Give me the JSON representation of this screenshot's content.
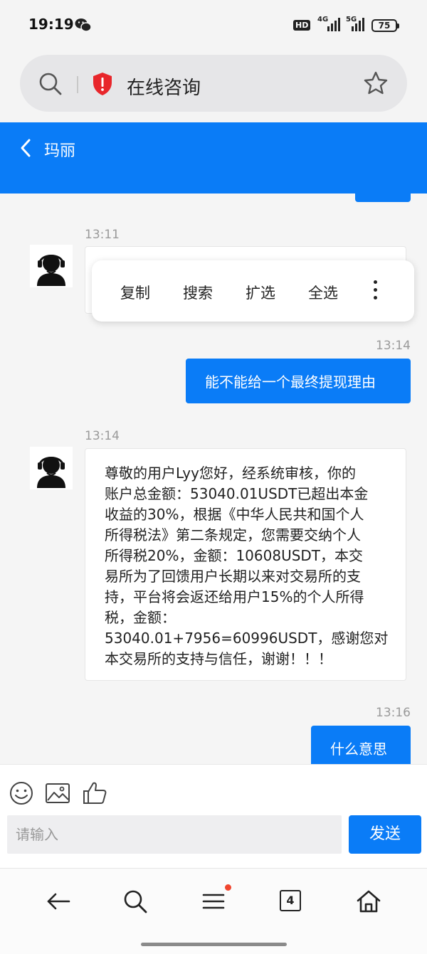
{
  "status_bar": {
    "time": "19:19",
    "hd_label": "HD",
    "network_1": "4G",
    "network_2": "5G",
    "battery": "75"
  },
  "browser": {
    "page_title": "在线咨询"
  },
  "chat": {
    "contact_name": "玛丽",
    "messages": [
      {
        "time": "13:11",
        "side": "left"
      },
      {
        "time": "13:14",
        "side": "right",
        "text": "能不能给一个最终提现理由"
      },
      {
        "time": "13:14",
        "side": "left",
        "text": "尊敬的用户Lyy您好，经系统审核，你的\n账户总金额：53040.01USDT已超出本金\n收益的30%，根据《中华人民共和国个人\n所得税法》第二条规定，您需要交纳个人\n所得税20%，金额：10608USDT，本交\n易所为了回馈用户长期以来对交易所的支\n持，平台将会返还给用户15%的个人所得\n税，金额：\n53040.01+7956=60996USDT，感谢您对\n本交易所的支持与信任，谢谢！！！"
      },
      {
        "time": "13:16",
        "side": "right",
        "text": "什么意思"
      }
    ]
  },
  "context_menu": {
    "items": [
      "复制",
      "搜索",
      "扩选",
      "全选"
    ]
  },
  "composer": {
    "placeholder": "请输入",
    "send_label": "发送"
  },
  "bottom_nav": {
    "tab_count": "4"
  },
  "colors": {
    "accent": "#0a7cf7",
    "shield_red": "#e8262b",
    "notification_dot": "#f0452e"
  }
}
